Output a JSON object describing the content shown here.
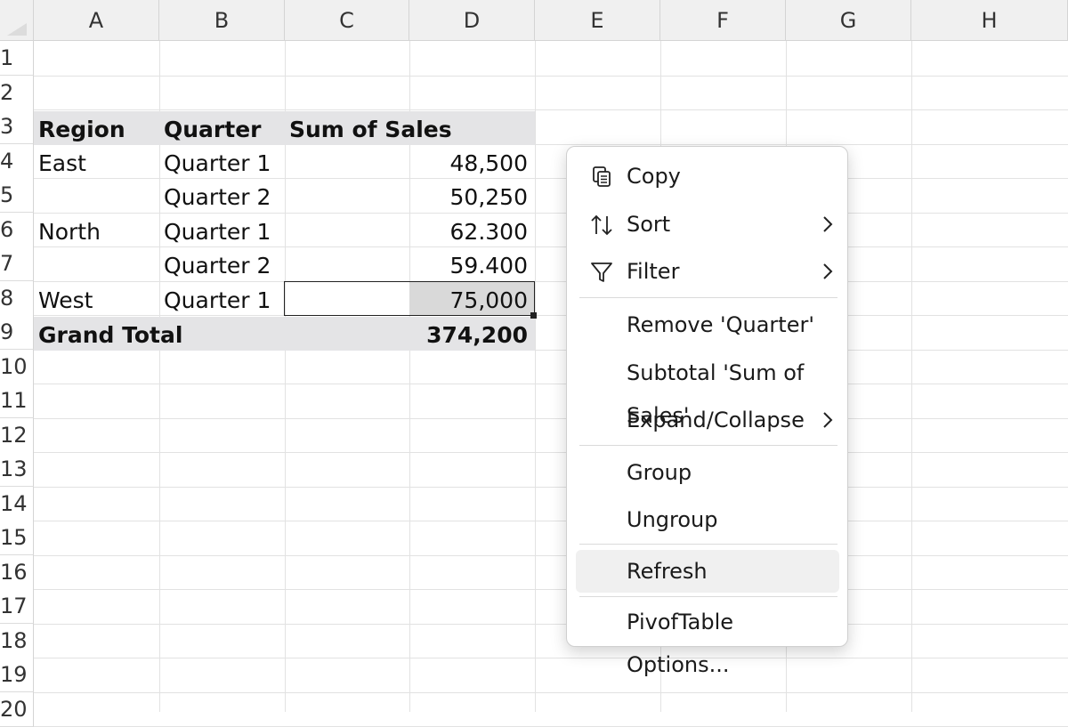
{
  "columns": [
    "A",
    "B",
    "C",
    "D",
    "E",
    "F",
    "G",
    "H"
  ],
  "rows": [
    "1",
    "2",
    "3",
    "4",
    "5",
    "6",
    "7",
    "8",
    "9",
    "10",
    "11",
    "12",
    "13",
    "14",
    "15",
    "16",
    "17",
    "18",
    "19",
    "20"
  ],
  "pivot": {
    "headers": {
      "region": "Region",
      "quarter": "Quarter",
      "sum": "Sum of Sales"
    },
    "rows": [
      {
        "region": "East",
        "quarter": "Quarter 1",
        "value": "48,500"
      },
      {
        "region": "",
        "quarter": "Quarter 2",
        "value": "50,250"
      },
      {
        "region": "North",
        "quarter": "Quarter 1",
        "value": "62.300"
      },
      {
        "region": "",
        "quarter": "Quarter 2",
        "value": "59.400"
      },
      {
        "region": "West",
        "quarter": "Quarter 1",
        "value": "75,000"
      }
    ],
    "grand_total_label": "Grand Total",
    "grand_total_value": "374,200"
  },
  "context_menu": {
    "items": [
      {
        "label": "Copy",
        "icon": "copy-icon"
      },
      {
        "label": "Sort",
        "icon": "sort-icon",
        "submenu": true
      },
      {
        "label": "Filter",
        "icon": "filter-icon",
        "submenu": true
      },
      {
        "label": "Remove 'Quarter'"
      },
      {
        "label": "Subtotal 'Sum of Sales'"
      },
      {
        "label": "Expand/Collapse",
        "submenu": true
      },
      {
        "label": "Group"
      },
      {
        "label": "Ungroup"
      },
      {
        "label": "Refresh",
        "highlighted": true
      },
      {
        "label": "PivofTable Options..."
      }
    ]
  },
  "colors": {
    "header_band": "#e4e4e6",
    "selection_fill": "#d9d9d9",
    "menu_hover": "#f0f0f0"
  }
}
